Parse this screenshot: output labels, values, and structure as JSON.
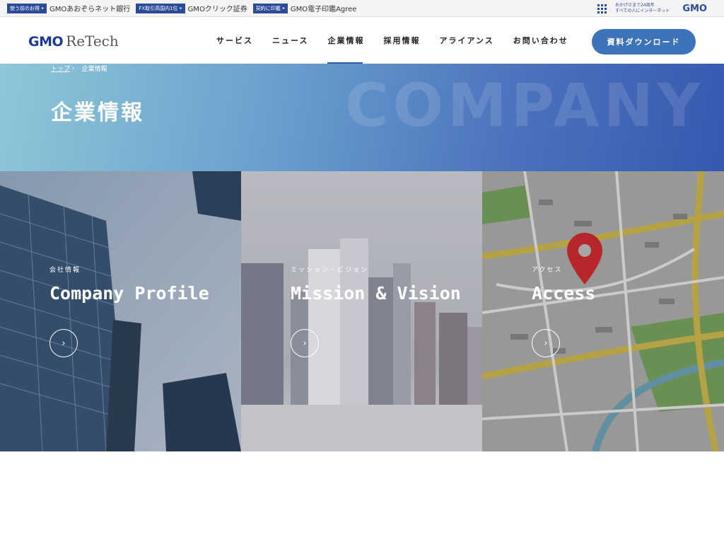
{
  "group_bar": {
    "items": [
      {
        "badge": "使う前のお得",
        "name": "GMOあおぞらネット銀行"
      },
      {
        "badge": "FX取引高国内1位",
        "name": "GMOクリック証券"
      },
      {
        "badge": "契約に印鑑",
        "name": "GMO電子印鑑Agree"
      }
    ],
    "anniversary_line1": "おかげさまで24周年",
    "anniversary_line2": "すべての人にインターネット",
    "group_logo": "GMO"
  },
  "header": {
    "logo_main": "GMO",
    "logo_sub": "ReTech",
    "nav": [
      {
        "label": "サービス",
        "active": false
      },
      {
        "label": "ニュース",
        "active": false
      },
      {
        "label": "企業情報",
        "active": true
      },
      {
        "label": "採用情報",
        "active": false
      },
      {
        "label": "アライアンス",
        "active": false
      },
      {
        "label": "お問い合わせ",
        "active": false
      }
    ],
    "download_button": "資料ダウンロード"
  },
  "hero": {
    "breadcrumb": [
      {
        "label": "トップ",
        "link": true
      },
      {
        "label": "企業情報",
        "link": false
      }
    ],
    "breadcrumb_separator": "›",
    "title": "企業情報",
    "background_text": "COMPANY"
  },
  "cards": [
    {
      "subtitle": "会社情報",
      "title": "Company Profile",
      "arrow": "›"
    },
    {
      "subtitle": "ミッション・ビジョン",
      "title": "Mission & Vision",
      "arrow": "›"
    },
    {
      "subtitle": "アクセス",
      "title": "Access",
      "arrow": "›"
    }
  ],
  "colors": {
    "brand": "#1c3c94",
    "accent": "#3d73b8",
    "nav_active": "#2c5bb0"
  }
}
